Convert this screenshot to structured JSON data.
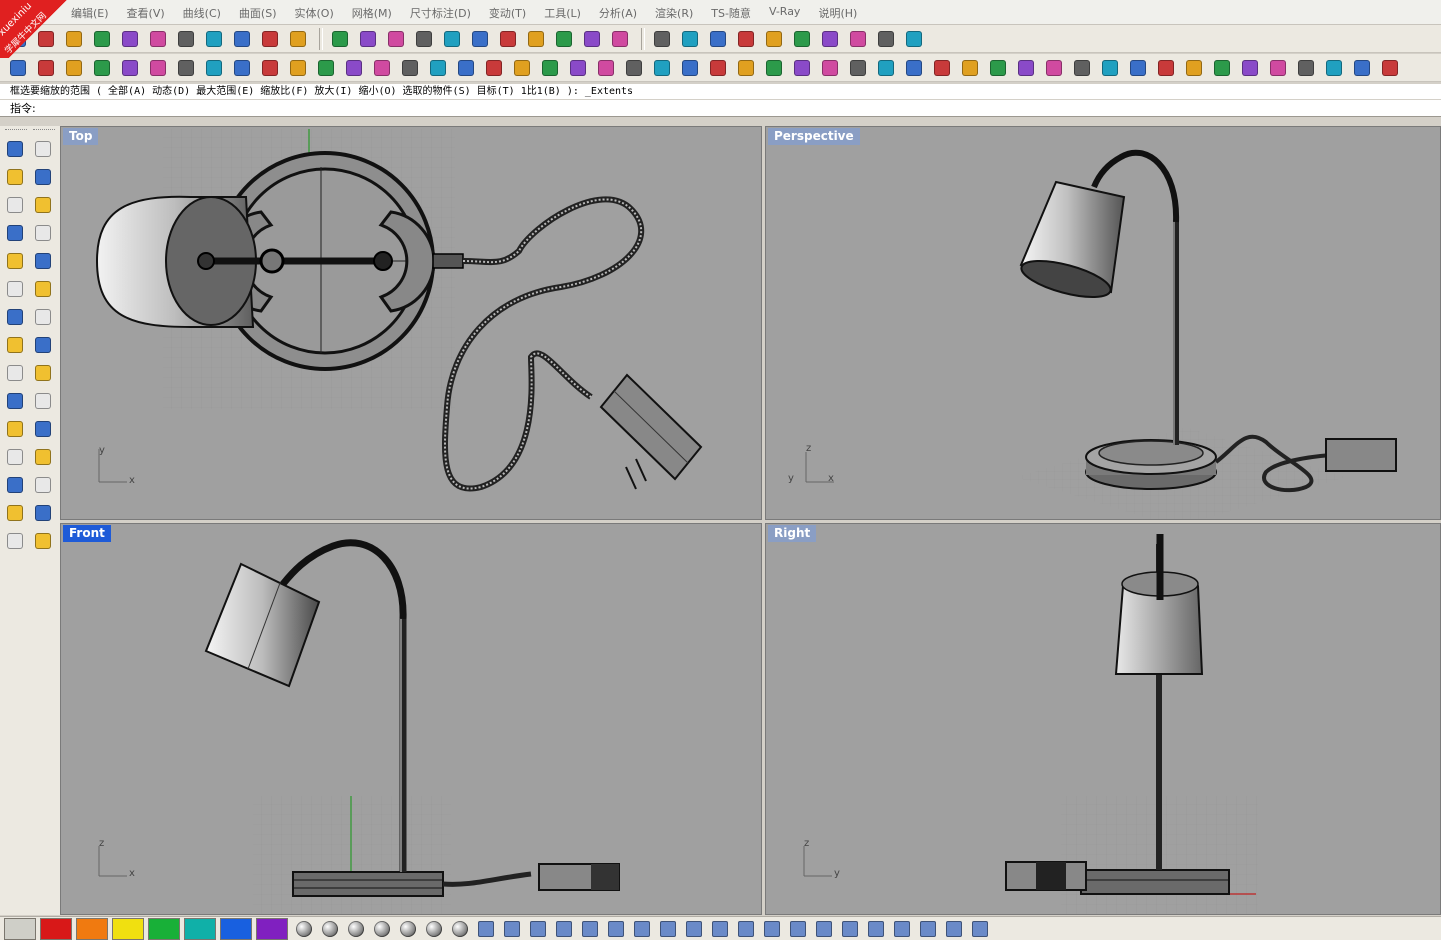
{
  "watermark": {
    "line1": "xuexiniu",
    "line2": "学犀牛中文网"
  },
  "menu": [
    "编辑(E)",
    "查看(V)",
    "曲线(C)",
    "曲面(S)",
    "实体(O)",
    "网格(M)",
    "尺寸标注(D)",
    "变动(T)",
    "工具(L)",
    "分析(A)",
    "渲染(R)",
    "TS-随意",
    "V-Ray",
    "说明(H)"
  ],
  "command_history": "框选要缩放的范围 ( 全部(A)  动态(D)  最大范围(E)  缩放比(F)  放大(I)  缩小(O)  选取的物件(S)  目标(T)  1比1(B) ): _Extents",
  "command_prompt": "指令:",
  "viewports": {
    "top": {
      "title": "Top",
      "axis_v": "y",
      "axis_h": "x"
    },
    "perspective": {
      "title": "Perspective",
      "axis_v": "z",
      "axis_h": "x",
      "axis_d": "y"
    },
    "front": {
      "title": "Front",
      "axis_v": "z",
      "axis_h": "x"
    },
    "right": {
      "title": "Right",
      "axis_v": "z",
      "axis_h": "y"
    }
  },
  "active_viewport": "front",
  "toolbar1_icons": [
    "new-file-icon",
    "open-file-icon",
    "save-icon",
    "print-icon",
    "export-icon",
    "cut-icon",
    "copy-icon",
    "paste-icon",
    "undo-icon",
    "pan-icon",
    "rotate-view-icon",
    "zoom-in-icon",
    "zoom-dynamic-icon",
    "zoom-extents-icon",
    "zoom-window-icon",
    "rotate-icon",
    "four-view-icon",
    "car-icon",
    "grid-plane-icon",
    "cplane-icon",
    "snap-icon",
    "light-bulb-icon",
    "lock-icon",
    "render-shield-icon",
    "color-wheel-icon",
    "shade-icon",
    "wire-sphere-icon",
    "render-sphere-icon",
    "pointer-flag-icon",
    "gear-icon",
    "dimension-icon",
    "help-icon"
  ],
  "toolbar2_icons": [
    "box-icon",
    "sphere-icon",
    "cube-icon",
    "curve-icon",
    "pen-icon",
    "axes-icon",
    "solid-icon",
    "grid-points-icon",
    "polygon-icon",
    "pentagon-icon",
    "surface-icon",
    "arch-icon",
    "extrude-icon",
    "fillet-icon",
    "box-edit-icon",
    "box-split-icon",
    "array-icon",
    "array-grid-icon",
    "magenta-box-icon",
    "mesh-icon",
    "lattice-icon",
    "magenta-grid-icon",
    "transform-icon",
    "morph-icon",
    "twist-icon",
    "plane-icon",
    "comb-icon",
    "box3-icon",
    "cup-icon",
    "cross-icon",
    "branch-icon",
    "star-icon",
    "target-icon",
    "spread-icon",
    "film-icon",
    "scroll-icon",
    "puzzle-icon",
    "tag-icon",
    "tag2-icon",
    "tag3-icon",
    "block-icon",
    "sun-icon",
    "diamond-icon",
    "clock-icon",
    "portrait-icon",
    "red-portrait-icon",
    "portrait2-icon",
    "portrait3-icon",
    "portrait4-icon",
    "window-icon"
  ],
  "status_colors": [
    "#cfcfc8",
    "#d81818",
    "#f07a10",
    "#f0e010",
    "#18b038",
    "#10b0a8",
    "#1860e0",
    "#8020c0"
  ],
  "status_icons": [
    "gray-sphere-icon",
    "gray-sphere2-icon",
    "gray-sphere3-icon",
    "gold-sphere-icon",
    "black-sphere-icon",
    "checker-sphere-icon",
    "blue-sphere-icon",
    "scale-icon",
    "measure-icon",
    "grid-icon",
    "bend-icon",
    "box-icon",
    "symmetry-icon",
    "diamond-icon",
    "dots-icon",
    "branch-icon",
    "check-icon",
    "grid2-icon",
    "circle-icon",
    "zigzag-icon",
    "gear-icon",
    "shape-icon",
    "curve-icon",
    "blend-icon",
    "hammer-icon",
    "flow-icon",
    "last-icon"
  ]
}
